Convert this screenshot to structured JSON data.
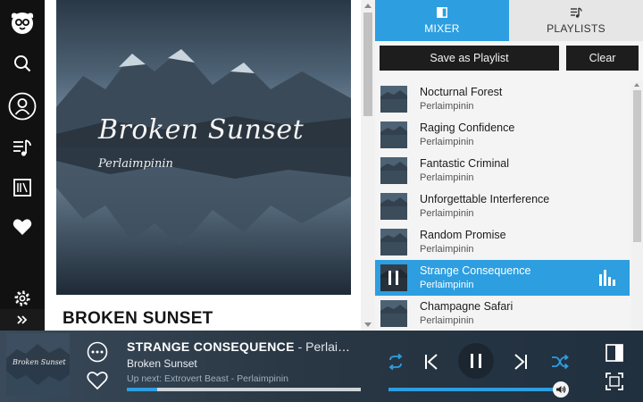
{
  "nav": {
    "items": [
      {
        "icon": "napster-logo-icon"
      },
      {
        "icon": "search-icon"
      },
      {
        "icon": "profile-icon"
      },
      {
        "icon": "music-library-icon"
      },
      {
        "icon": "radio-icon"
      },
      {
        "icon": "heart-icon"
      },
      {
        "icon": "gear-icon"
      },
      {
        "icon": "expand-chevrons-icon"
      }
    ]
  },
  "album": {
    "art_title": "Broken Sunset",
    "art_artist": "Perlaimpinin",
    "title": "BROKEN SUNSET"
  },
  "right_panel": {
    "tabs": [
      {
        "label": "MIXER",
        "icon": "mixer-icon",
        "active": true
      },
      {
        "label": "PLAYLISTS",
        "icon": "playlist-icon",
        "active": false
      }
    ],
    "save_label": "Save as Playlist",
    "clear_label": "Clear",
    "queue": [
      {
        "title": "Nocturnal Forest",
        "artist": "Perlaimpinin",
        "playing": false
      },
      {
        "title": "Raging Confidence",
        "artist": "Perlaimpinin",
        "playing": false
      },
      {
        "title": "Fantastic Criminal",
        "artist": "Perlaimpinin",
        "playing": false
      },
      {
        "title": "Unforgettable Interference",
        "artist": "Perlaimpinin",
        "playing": false
      },
      {
        "title": "Random Promise",
        "artist": "Perlaimpinin",
        "playing": false
      },
      {
        "title": "Strange Consequence",
        "artist": "Perlaimpinin",
        "playing": true
      },
      {
        "title": "Champagne Safari",
        "artist": "Perlaimpinin",
        "playing": false
      }
    ]
  },
  "player": {
    "now_playing_title": "STRANGE CONSEQUENCE",
    "now_playing_artist": " - Perlaimpinin",
    "album": "Broken Sunset",
    "up_next": "Up next: Extrovert Beast - Perlaimpinin",
    "art_title": "Broken Sunset",
    "progress": 0.13,
    "volume": 1.0
  },
  "colors": {
    "accent": "#2d9ee0",
    "nav_bg": "#111111",
    "player_bg": "#2a3744"
  }
}
